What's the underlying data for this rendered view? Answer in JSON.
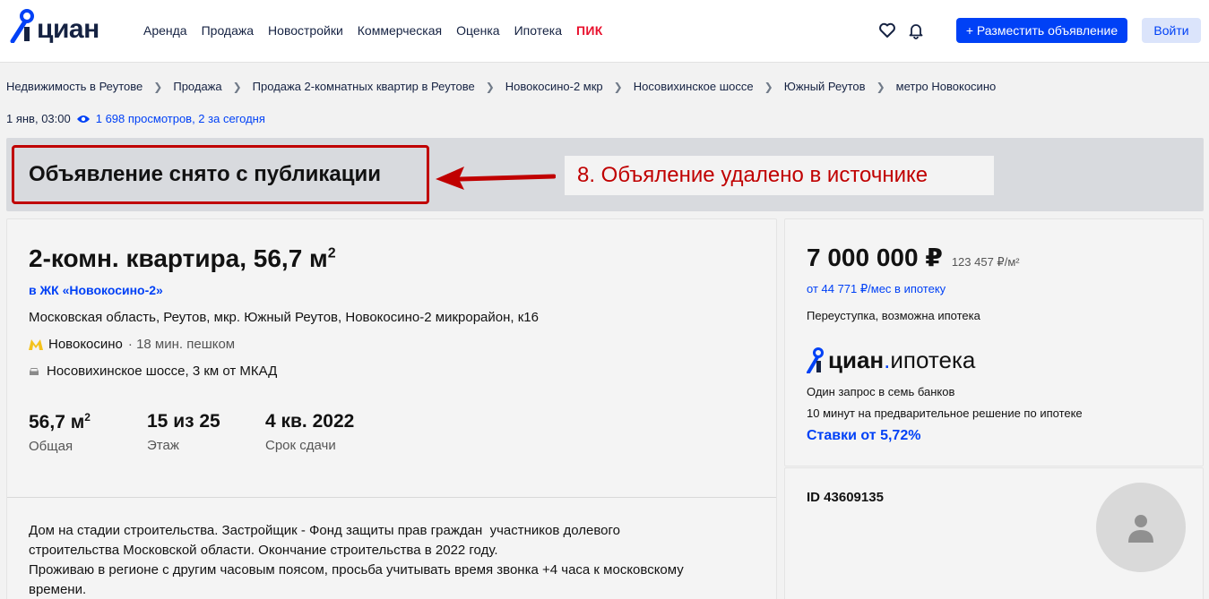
{
  "header": {
    "logo_text": "циан",
    "nav": [
      "Аренда",
      "Продажа",
      "Новостройки",
      "Коммерческая",
      "Оценка",
      "Ипотека"
    ],
    "nav_pik": "ПИК",
    "place_button": "+ Разместить объявление",
    "login_button": "Войти",
    "icons": [
      "heart-icon",
      "bell-icon"
    ]
  },
  "breadcrumbs": [
    "Недвижимость в Реутове",
    "Продажа",
    "Продажа 2-комнатных квартир в Реутове",
    "Новокосино-2 мкр",
    "Носовихинское шоссе",
    "Южный Реутов",
    "метро Новокосино"
  ],
  "meta": {
    "date": "1 янв, 03:00",
    "views": "1 698 просмотров, 2 за сегодня"
  },
  "status": {
    "removed_title": "Объявление снято с публикации",
    "annotation": "8. Объяление удалено в источнике",
    "annotation_color": "#c00000"
  },
  "listing": {
    "title": "2-комн. квартира, 56,7 м",
    "title_sup": "2",
    "complex": "в ЖК «Новокосино-2»",
    "address": "Московская область, Реутов, мкр. Южный Реутов, Новокосино-2 микрорайон, к16",
    "metro": "Новокосино",
    "metro_walk": "· 18 мин. пешком",
    "road": "Носовихинское шоссе, 3 км от МКАД",
    "stats": [
      {
        "value": "56,7 м",
        "sup": "2",
        "label": "Общая"
      },
      {
        "value": "15 из 25",
        "sup": "",
        "label": "Этаж"
      },
      {
        "value": "4 кв. 2022",
        "sup": "",
        "label": "Срок сдачи"
      }
    ],
    "description": "Дом на стадии строительства. Застройщик - Фонд защиты прав граждан  участников долевого\nстроительства Московской области. Окончание строительства в 2022 году.\nПроживаю в регионе с другим часовым поясом, просьба учитывать время звонка +4 часа к московскому\nвремени."
  },
  "price_card": {
    "price": "7 000 000 ₽",
    "price_per_m": "123 457 ₽/м²",
    "mortgage": "от 44 771 ₽/мес в ипотеку",
    "deal": "Переуступка, возможна ипотека",
    "ipoteka_logo": {
      "cian": "циан",
      "dot": ".",
      "word": "ипотека"
    },
    "one_request": "Один запрос в семь банков",
    "ten_min": "10 минут на предварительное решение по ипотеке",
    "rates": "Ставки от 5,72%"
  },
  "agent": {
    "id": "ID 43609135"
  },
  "colors": {
    "brand_blue": "#0041f6",
    "pik_red": "#e8112d",
    "metro_yellow": "#f4c21b"
  }
}
